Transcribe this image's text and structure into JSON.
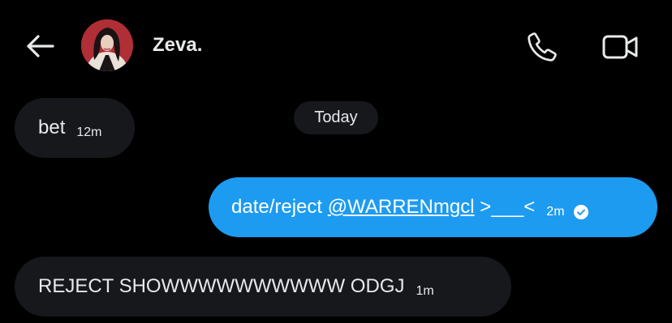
{
  "header": {
    "contact_name": "Zeva.",
    "back_icon": "arrow-left-icon",
    "call_icon": "phone-icon",
    "video_icon": "video-camera-icon"
  },
  "date_separator": "Today",
  "messages": [
    {
      "direction": "incoming",
      "text": "bet",
      "time": "12m"
    },
    {
      "direction": "outgoing",
      "text_before": "date/reject ",
      "mention": "@WARRENmgcl",
      "text_after": " >___<",
      "time": "2m",
      "status_icon": "seen-check-icon"
    },
    {
      "direction": "incoming",
      "text": "REJECT SHOWWWWWWWWWW ODGJ",
      "time": "1m"
    }
  ],
  "colors": {
    "background": "#000000",
    "incoming_bubble": "#16181c",
    "outgoing_bubble": "#1d9bf0",
    "text": "#e7e9ea"
  }
}
